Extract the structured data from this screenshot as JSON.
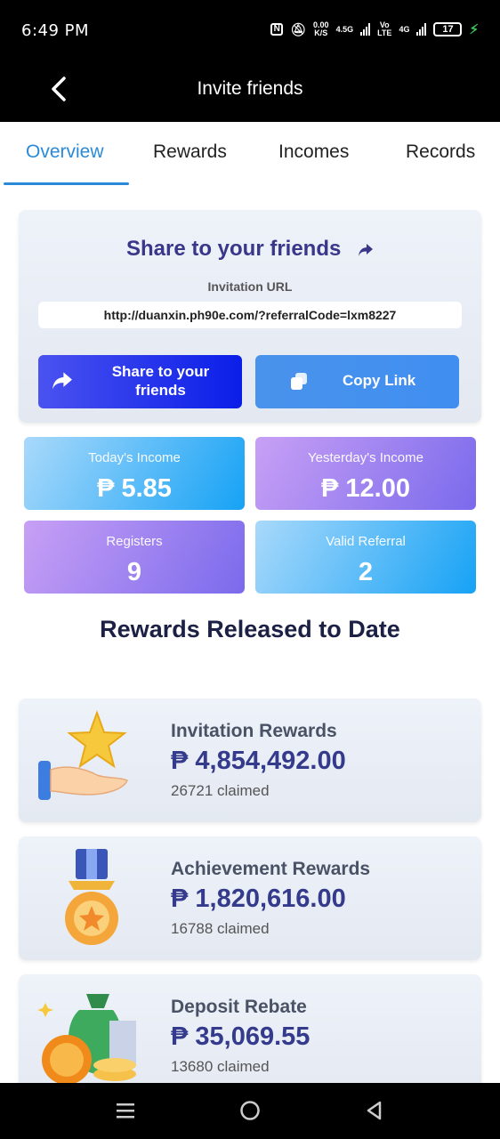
{
  "status_bar": {
    "time": "6:49 PM",
    "speed_value": "0.00",
    "speed_unit": "K/S",
    "net1": "4.5G",
    "volte_top": "Vo",
    "volte_bottom": "LTE",
    "net2": "4G",
    "battery": "17"
  },
  "app_bar": {
    "title": "Invite friends"
  },
  "tabs": [
    {
      "label": "Overview",
      "active": true
    },
    {
      "label": "Rewards",
      "active": false
    },
    {
      "label": "Incomes",
      "active": false
    },
    {
      "label": "Records",
      "active": false
    }
  ],
  "share": {
    "title": "Share to your friends",
    "url_label": "Invitation URL",
    "url": "http://duanxin.ph90e.com/?referralCode=lxm8227",
    "share_button": "Share to your friends",
    "copy_button": "Copy Link"
  },
  "stats": [
    {
      "label": "Today's Income",
      "value": "₱ 5.85"
    },
    {
      "label": "Yesterday's Income",
      "value": "₱ 12.00"
    },
    {
      "label": "Registers",
      "value": "9"
    },
    {
      "label": "Valid Referral",
      "value": "2"
    }
  ],
  "rewards_heading": "Rewards Released to Date",
  "rewards": [
    {
      "title": "Invitation Rewards",
      "amount": "₱ 4,854,492.00",
      "claimed": "26721 claimed"
    },
    {
      "title": "Achievement Rewards",
      "amount": "₱ 1,820,616.00",
      "claimed": "16788 claimed"
    },
    {
      "title": "Deposit Rebate",
      "amount": "₱ 35,069.55",
      "claimed": "13680 claimed"
    }
  ],
  "colors": {
    "accent": "#2a8ad8",
    "title_purple": "#3a3689",
    "share_button": "#0a1ee8",
    "copy_button": "#3f8ef0"
  },
  "icons": {
    "back": "chevron-left-icon",
    "share": "share-arrow-icon",
    "copy": "copy-icon",
    "invitation": "hand-star-icon",
    "achievement": "medal-icon",
    "deposit": "money-bag-icon"
  }
}
